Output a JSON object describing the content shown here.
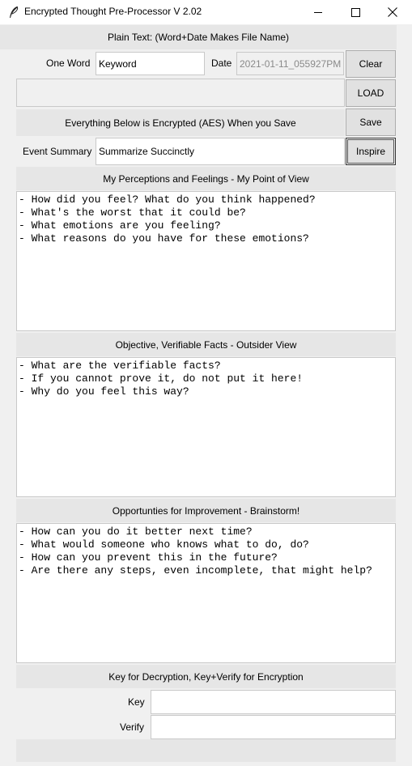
{
  "window": {
    "title": "Encrypted Thought Pre-Processor V 2.02",
    "minimize_glyph": "—",
    "maximize_glyph": "☐",
    "close_glyph": "✕"
  },
  "header": {
    "plain_text_label": "Plain Text: (Word+Date Makes File Name)",
    "one_word_label": "One Word",
    "one_word_value": "Keyword",
    "date_label": "Date",
    "date_value": "2021-01-11_055927PM",
    "clear_button": "Clear",
    "load_button": "LOAD",
    "encrypted_notice": "Everything Below is Encrypted (AES) When you Save",
    "save_button": "Save",
    "event_summary_label": "Event Summary",
    "event_summary_value": "Summarize Succinctly",
    "inspire_button": "Inspire"
  },
  "sections": {
    "perceptions": {
      "heading": "My Perceptions and Feelings - My Point of View",
      "text": "- How did you feel? What do you think happened?\n- What's the worst that it could be?\n- What emotions are you feeling?\n- What reasons do you have for these emotions?"
    },
    "facts": {
      "heading": "Objective, Verifiable Facts - Outsider View",
      "text": "- What are the verifiable facts?\n- If you cannot prove it, do not put it here!\n- Why do you feel this way?"
    },
    "improvement": {
      "heading": "Opportunties for Improvement - Brainstorm!",
      "text": "- How can you do it better next time?\n- What would someone who knows what to do, do?\n- How can you prevent this in the future?\n- Are there any steps, even incomplete, that might help?"
    }
  },
  "keys": {
    "heading": "Key for Decryption, Key+Verify for Encryption",
    "key_label": "Key",
    "key_value": "",
    "verify_label": "Verify",
    "verify_value": ""
  }
}
